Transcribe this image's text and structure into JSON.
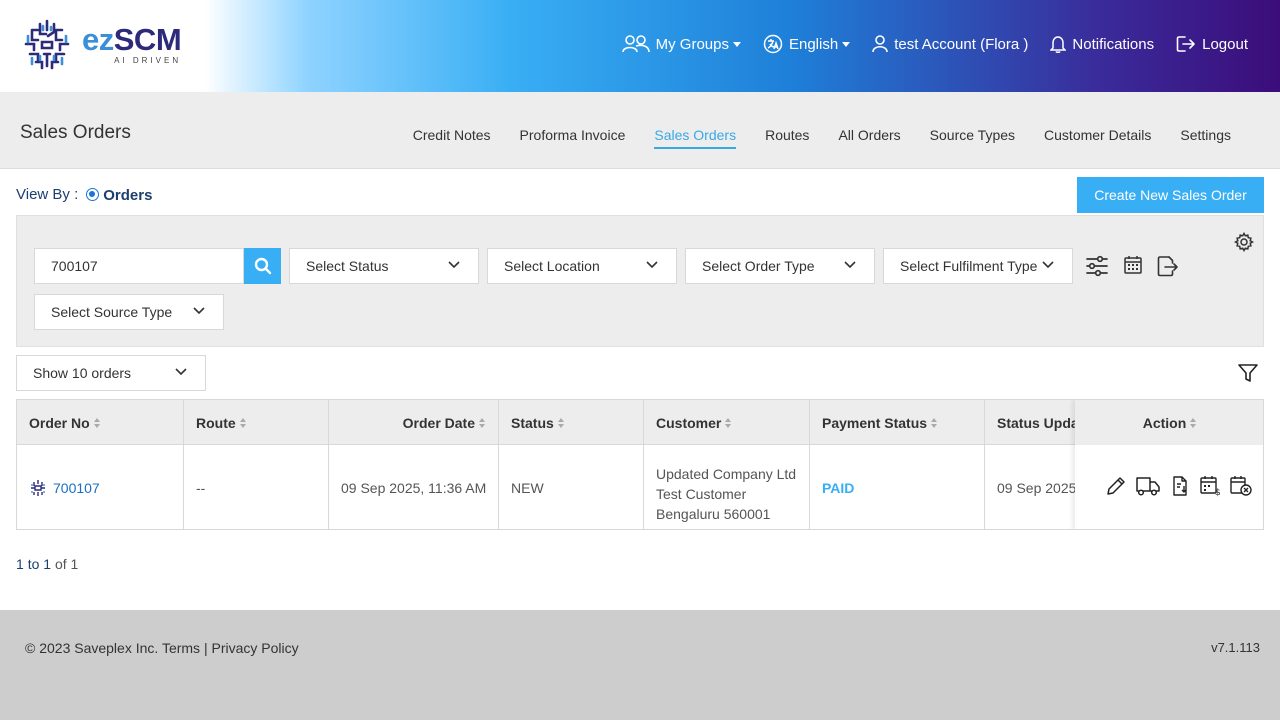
{
  "app": {
    "logo_ez": "ez",
    "logo_scm": "SCM",
    "logo_sub": "AI DRIVEN"
  },
  "topnav": {
    "groups": "My Groups",
    "language": "English",
    "account": "test Account (Flora )",
    "notifications": "Notifications",
    "logout": "Logout"
  },
  "page": {
    "title": "Sales Orders",
    "tabs": [
      {
        "label": "Credit Notes",
        "active": false
      },
      {
        "label": "Proforma Invoice",
        "active": false
      },
      {
        "label": "Sales Orders",
        "active": true
      },
      {
        "label": "Routes",
        "active": false
      },
      {
        "label": "All Orders",
        "active": false
      },
      {
        "label": "Source Types",
        "active": false
      },
      {
        "label": "Customer Details",
        "active": false
      },
      {
        "label": "Settings",
        "active": false
      }
    ]
  },
  "viewby": {
    "label": "View By :",
    "option": "Orders"
  },
  "create_button": "Create New Sales Order",
  "filters": {
    "search_value": "700107",
    "status": "Select Status",
    "location": "Select Location",
    "order_type": "Select Order Type",
    "fulfilment_type": "Select Fulfilment Type",
    "source_type": "Select Source Type"
  },
  "show": "Show 10 orders",
  "table": {
    "headers": [
      "Order No",
      "Route",
      "Order Date",
      "Status",
      "Customer",
      "Payment Status",
      "Status Upda",
      "Action"
    ],
    "rows": [
      {
        "order_no": "700107",
        "route": "--",
        "order_date": "09 Sep 2025, 11:36 AM",
        "status": "NEW",
        "customer_line1": "Updated Company Ltd",
        "customer_line2": "Test Customer",
        "customer_line3": "Bengaluru 560001",
        "payment_status": "PAID",
        "status_updated": "09 Sep 2025"
      }
    ]
  },
  "pager": {
    "from": "1",
    "to_word": "to",
    "to": "1",
    "of_word": "of",
    "total": "1"
  },
  "footer": {
    "copyright": "© 2023 Saveplex Inc.",
    "terms": "Terms",
    "separator": "|",
    "privacy": "Privacy Policy",
    "version": "v7.1.113"
  },
  "colors": {
    "accent": "#38aef4",
    "brand_dark": "#2d2a7a",
    "panel": "#ededed"
  }
}
